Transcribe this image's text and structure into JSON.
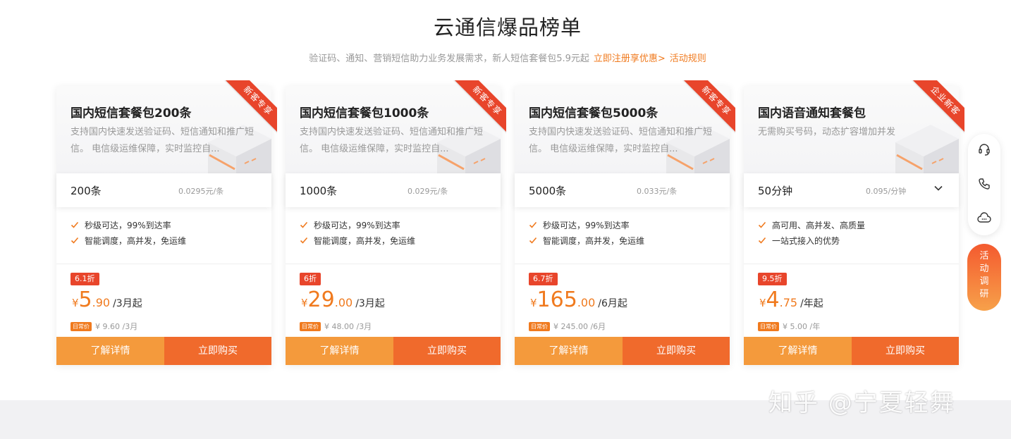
{
  "header": {
    "title": "云通信爆品榜单",
    "subtitle": "验证码、通知、营销短信助力业务发展需求，新人短信套餐包5.9元起",
    "register_link": "立即注册享优惠>",
    "rules_link": "活动规则"
  },
  "cards": [
    {
      "name": "国内短信套餐包200条",
      "desc": "支持国内快速发送验证码、短信通知和推广短信。 电信级运维保障，实时监控自...",
      "ribbon": "新客专享",
      "spec": "200条",
      "unit_price": "0.0295元/条",
      "features": [
        "秒级可达，99%到达率",
        "智能调度，高并发，免运维"
      ],
      "discount": "6.1折",
      "yen": "¥",
      "price_int": "5",
      "price_dec": ".90",
      "price_unit": "/3月起",
      "normal_tag": "日常价",
      "normal_price": "¥ 9.60 /3月",
      "detail_label": "了解详情",
      "buy_label": "立即购买"
    },
    {
      "name": "国内短信套餐包1000条",
      "desc": "支持国内快速发送验证码、短信通知和推广短信。 电信级运维保障，实时监控自...",
      "ribbon": "新客专享",
      "spec": "1000条",
      "unit_price": "0.029元/条",
      "features": [
        "秒级可达，99%到达率",
        "智能调度，高并发，免运维"
      ],
      "discount": "6折",
      "yen": "¥",
      "price_int": "29",
      "price_dec": ".00",
      "price_unit": "/3月起",
      "normal_tag": "日常价",
      "normal_price": "¥ 48.00 /3月",
      "detail_label": "了解详情",
      "buy_label": "立即购买"
    },
    {
      "name": "国内短信套餐包5000条",
      "desc": "支持国内快速发送验证码、短信通知和推广短信。 电信级运维保障，实时监控自...",
      "ribbon": "新客专享",
      "spec": "5000条",
      "unit_price": "0.033元/条",
      "features": [
        "秒级可达，99%到达率",
        "智能调度，高并发，免运维"
      ],
      "discount": "6.7折",
      "yen": "¥",
      "price_int": "165",
      "price_dec": ".00",
      "price_unit": "/6月起",
      "normal_tag": "日常价",
      "normal_price": "¥ 245.00 /6月",
      "detail_label": "了解详情",
      "buy_label": "立即购买"
    },
    {
      "name": "国内语音通知套餐包",
      "desc": "无需购买号码，动态扩容增加并发",
      "ribbon": "企业新客",
      "spec": "50分钟",
      "unit_price": "0.095/分钟",
      "features": [
        "高可用、高并发、高质量",
        "一站式接入的优势"
      ],
      "discount": "9.5折",
      "yen": "¥",
      "price_int": "4",
      "price_dec": ".75",
      "price_unit": "/年起",
      "normal_tag": "日常价",
      "normal_price": "¥ 5.00 /年",
      "detail_label": "了解详情",
      "buy_label": "立即购买"
    }
  ],
  "side": {
    "icons": [
      "headset-icon",
      "phone-icon",
      "chat-cloud-icon"
    ],
    "survey_label": "活动调研"
  },
  "watermark": "知乎 @宁夏轻舞",
  "colors": {
    "accent_orange": "#f07a1e",
    "ribbon_red": "#e8452b",
    "detail_button": "#f49a3c",
    "buy_button": "#f06a2c"
  }
}
